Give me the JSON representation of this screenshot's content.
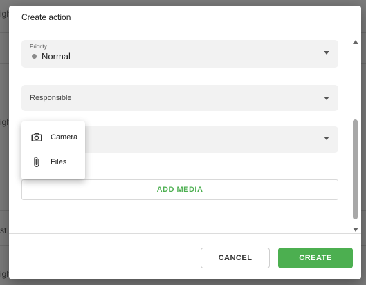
{
  "background": {
    "fragments": [
      "igh",
      "igh",
      "st",
      "igh"
    ]
  },
  "dialog": {
    "title": "Create action",
    "priority": {
      "label": "Priority",
      "value": "Normal"
    },
    "responsible": {
      "placeholder": "Responsible"
    },
    "add_media_label": "ADD MEDIA",
    "cancel_label": "CANCEL",
    "create_label": "CREATE"
  },
  "media_menu": {
    "items": [
      {
        "label": "Camera",
        "icon": "camera-icon"
      },
      {
        "label": "Files",
        "icon": "paperclip-icon"
      }
    ]
  },
  "colors": {
    "accent": "#4caf50",
    "overlay": "#7b7b7b"
  }
}
